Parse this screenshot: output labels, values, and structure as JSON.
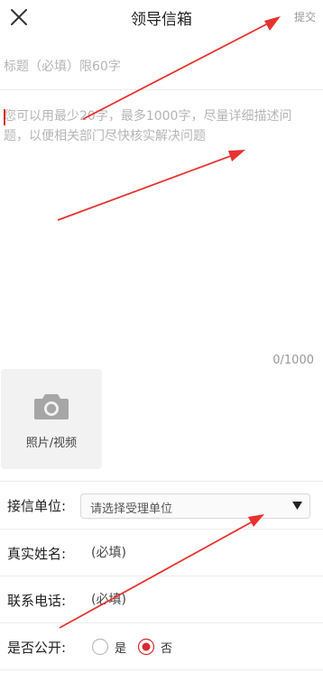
{
  "header": {
    "title": "领导信箱",
    "submit_label": "提交"
  },
  "form": {
    "title_placeholder": "标题（必填）限60字",
    "content_placeholder": "您可以用最少20字，最多1000字，尽量详细描述问题，以便相关部门尽快核实解决问题",
    "counter": "0/1000",
    "media_label": "照片/视频",
    "recipient": {
      "label": "接信单位:",
      "placeholder": "请选择受理单位"
    },
    "name": {
      "label": "真实姓名:",
      "placeholder": "(必填)"
    },
    "phone": {
      "label": "联系电话:",
      "placeholder": "(必填)"
    },
    "public": {
      "label": "是否公开:",
      "options": [
        "是",
        "否"
      ],
      "selected": "否"
    }
  },
  "colors": {
    "accent": "#d8282c",
    "annotation_arrow": "#e8322f"
  }
}
